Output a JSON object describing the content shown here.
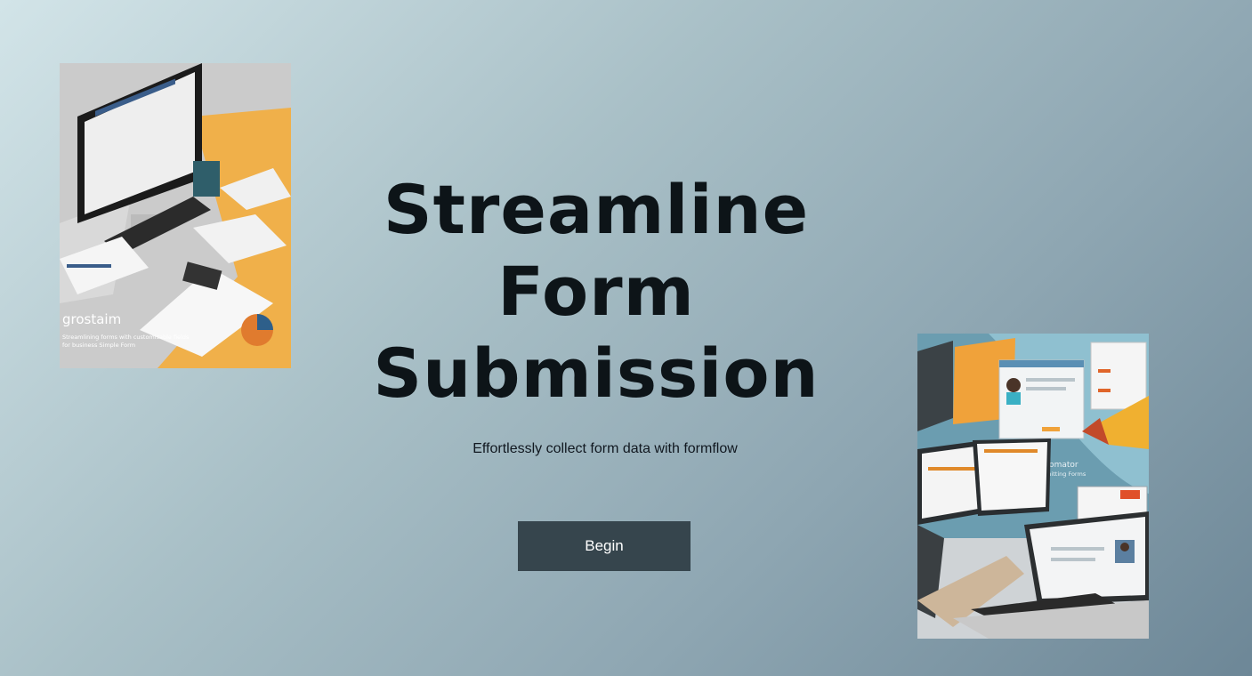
{
  "hero": {
    "title_lines": [
      "Streamline",
      "Form",
      "Submission"
    ],
    "subtitle": "Effortlessly collect form data with formflow",
    "cta_label": "Begin"
  },
  "images": {
    "left": {
      "description_name": "workspace-illustration",
      "caption_title": "grostaim",
      "caption_line1": "Streamlining forms with customisable fields",
      "caption_line2": "for business Simple Form"
    },
    "right": {
      "description_name": "laptops-illustration",
      "caption_title": "FormAutomator",
      "caption_line1": "Smart Submitting Forms"
    }
  },
  "colors": {
    "accent_orange": "#f0b04a",
    "button_bg": "#36454d",
    "title_text": "#0d1418"
  }
}
